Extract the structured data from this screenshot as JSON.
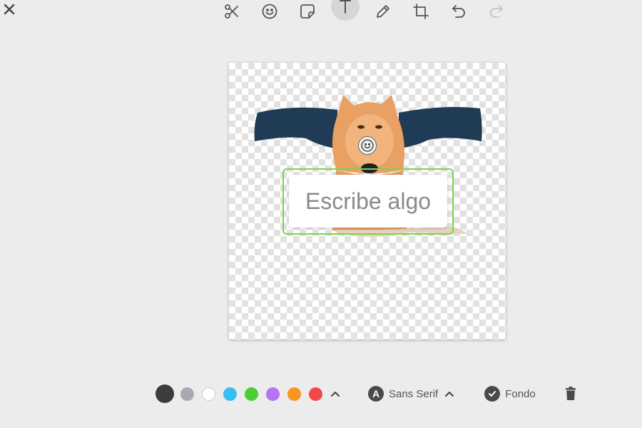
{
  "toolbar": {
    "tools": [
      {
        "name": "scissors-icon",
        "active": false
      },
      {
        "name": "emoji-icon",
        "active": false
      },
      {
        "name": "sticker-icon",
        "active": false
      },
      {
        "name": "text-icon",
        "active": true
      },
      {
        "name": "pencil-icon",
        "active": false
      },
      {
        "name": "crop-icon",
        "active": false
      },
      {
        "name": "undo-icon",
        "active": false
      },
      {
        "name": "redo-icon",
        "active": false
      }
    ],
    "close_icon": "close-icon"
  },
  "editor": {
    "text_placeholder": "Escribe algo",
    "frame_color": "#7bd44b"
  },
  "bottom": {
    "colors": [
      "#3c3c3c",
      "#a9a9b3",
      "#ffffff",
      "#37bdf2",
      "#4cce34",
      "#b673f4",
      "#f7961e",
      "#f24848"
    ],
    "selected_color_index": 0,
    "font_letter": "A",
    "font_label": "Sans Serif",
    "background_label": "Fondo"
  }
}
